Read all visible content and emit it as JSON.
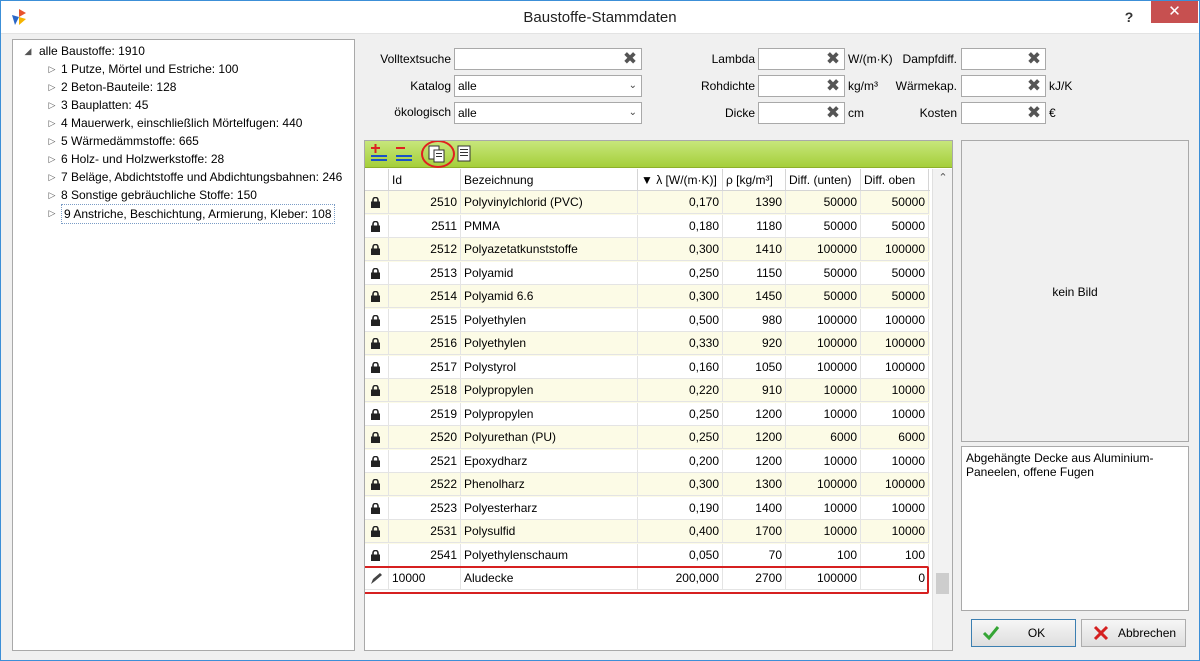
{
  "window": {
    "title": "Baustoffe-Stammdaten",
    "help": "?",
    "close": "✕"
  },
  "tree": {
    "root": "alle Baustoffe: 1910",
    "items": [
      "1 Putze, Mörtel und Estriche: 100",
      "2 Beton-Bauteile: 128",
      "3 Bauplatten: 45",
      "4 Mauerwerk, einschließlich Mörtelfugen: 440",
      "5 Wärmedämmstoffe: 665",
      "6 Holz- und Holzwerkstoffe: 28",
      "7 Beläge, Abdichtstoffe und Abdichtungsbahnen: 246",
      "8 Sonstige gebräuchliche Stoffe: 150",
      "9 Anstriche, Beschichtung, Armierung, Kleber: 108"
    ]
  },
  "filters": {
    "volltext_label": "Volltextsuche",
    "volltext_value": "",
    "katalog_label": "Katalog",
    "katalog_value": "alle",
    "oekologisch_label": "ökologisch",
    "oekologisch_value": "alle",
    "lambda_label": "Lambda",
    "lambda_unit": "W/(m·K)",
    "rohdichte_label": "Rohdichte",
    "rohdichte_unit": "kg/m³",
    "dicke_label": "Dicke",
    "dicke_unit": "cm",
    "dampf_label": "Dampfdiff.",
    "waerme_label": "Wärmekap.",
    "waerme_unit": "kJ/K",
    "kosten_label": "Kosten",
    "kosten_unit": "€",
    "clear_glyph": "✖",
    "arrow_glyph": "⌄"
  },
  "grid": {
    "columns": [
      "Id",
      "Bezeichnung",
      "▼ λ [W/(m·K)]",
      "ρ [kg/m³]",
      "Diff. (unten)",
      "Diff. oben"
    ],
    "rows": [
      [
        "2510",
        "Polyvinylchlorid (PVC)",
        "0,170",
        "1390",
        "50000",
        "50000"
      ],
      [
        "2511",
        "PMMA",
        "0,180",
        "1180",
        "50000",
        "50000"
      ],
      [
        "2512",
        "Polyazetatkunststoffe",
        "0,300",
        "1410",
        "100000",
        "100000"
      ],
      [
        "2513",
        "Polyamid",
        "0,250",
        "1150",
        "50000",
        "50000"
      ],
      [
        "2514",
        "Polyamid 6.6",
        "0,300",
        "1450",
        "50000",
        "50000"
      ],
      [
        "2515",
        "Polyethylen",
        "0,500",
        "980",
        "100000",
        "100000"
      ],
      [
        "2516",
        "Polyethylen",
        "0,330",
        "920",
        "100000",
        "100000"
      ],
      [
        "2517",
        "Polystyrol",
        "0,160",
        "1050",
        "100000",
        "100000"
      ],
      [
        "2518",
        "Polypropylen",
        "0,220",
        "910",
        "10000",
        "10000"
      ],
      [
        "2519",
        "Polypropylen",
        "0,250",
        "1200",
        "10000",
        "10000"
      ],
      [
        "2520",
        "Polyurethan (PU)",
        "0,250",
        "1200",
        "6000",
        "6000"
      ],
      [
        "2521",
        "Epoxydharz",
        "0,200",
        "1200",
        "10000",
        "10000"
      ],
      [
        "2522",
        "Phenolharz",
        "0,300",
        "1300",
        "100000",
        "100000"
      ],
      [
        "2523",
        "Polyesterharz",
        "0,190",
        "1400",
        "10000",
        "10000"
      ],
      [
        "2531",
        "Polysulfid",
        "0,400",
        "1700",
        "10000",
        "10000"
      ],
      [
        "2541",
        "Polyethylenschaum",
        "0,050",
        "70",
        "100",
        "100"
      ]
    ],
    "edit_row": [
      "10000",
      "Aludecke",
      "200,000",
      "2700",
      "100000",
      "0"
    ]
  },
  "image_placeholder": "kein Bild",
  "description": "Abgehängte Decke aus Aluminium-Paneelen, offene Fugen",
  "buttons": {
    "ok": "OK",
    "cancel": "Abbrechen"
  }
}
